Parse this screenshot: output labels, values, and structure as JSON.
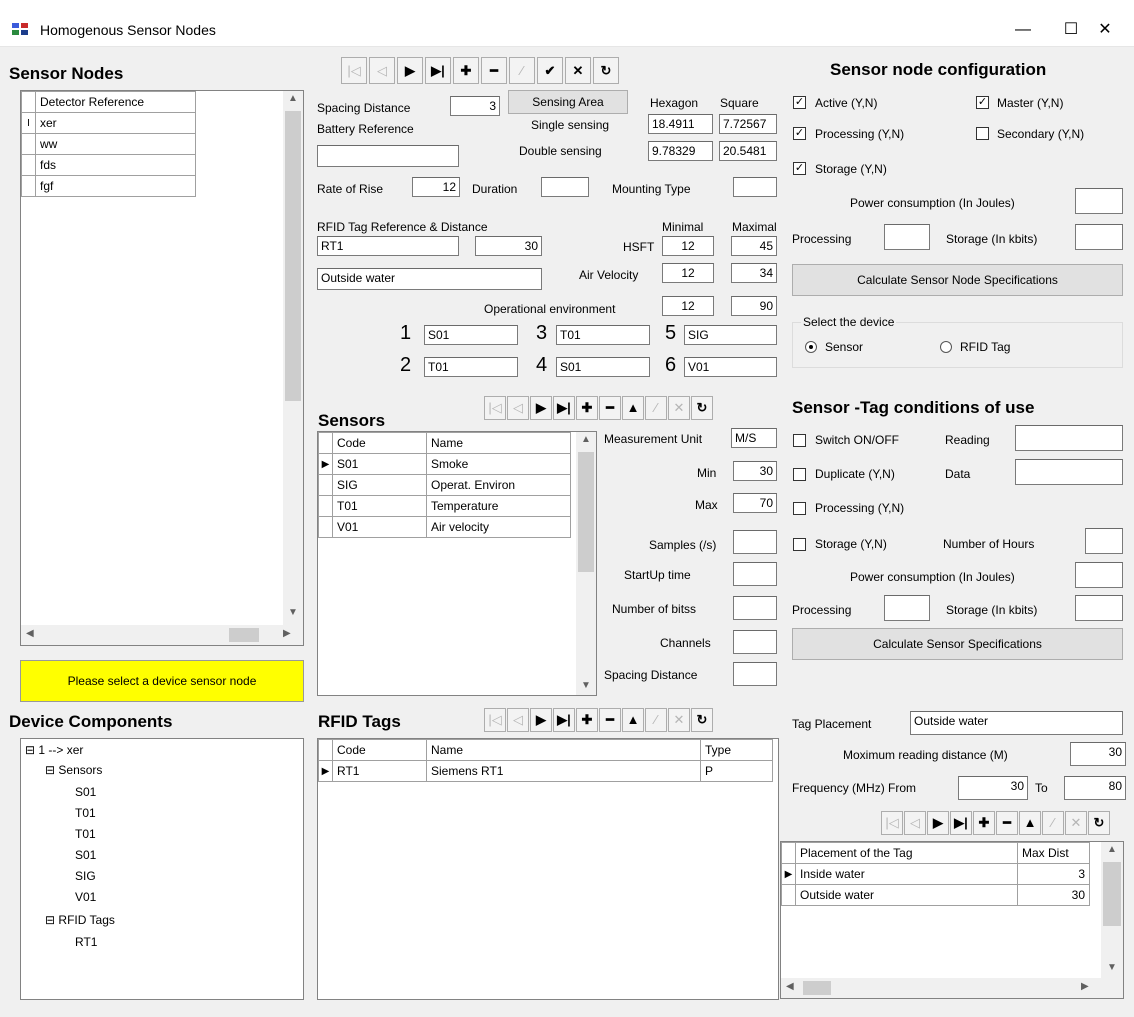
{
  "window": {
    "title": "Homogenous Sensor Nodes",
    "minimize": "—",
    "maximize": "☐",
    "close": "✕"
  },
  "sensor_nodes": {
    "header": "Sensor Nodes",
    "column": "Detector Reference",
    "rows": [
      "xer",
      "ww",
      "fds",
      "fgf"
    ],
    "status": "Please select a device sensor node"
  },
  "device_components": {
    "header": "Device Components",
    "root": "1 --> xer",
    "sensors_label": "Sensors",
    "sensors": [
      "S01",
      "T01",
      "T01",
      "S01",
      "SIG",
      "V01"
    ],
    "tags_label": "RFID Tags",
    "tags": [
      "RT1"
    ]
  },
  "node_form": {
    "spacing_distance_label": "Spacing Distance",
    "spacing_distance": "3",
    "sensing_area_btn": "Sensing Area",
    "hexagon_label": "Hexagon",
    "square_label": "Square",
    "single_sensing_label": "Single sensing",
    "single_hex": "18.4911",
    "single_sq": "7.72567",
    "double_sensing_label": "Double sensing",
    "double_hex": "9.78329",
    "double_sq": "20.5481",
    "battery_reference_label": "Battery Reference",
    "battery_reference": "",
    "rate_of_rise_label": "Rate of Rise",
    "rate_of_rise": "12",
    "duration_label": "Duration",
    "duration": "",
    "mounting_type_label": "Mounting Type",
    "mounting_type": "",
    "rfid_label": "RFID Tag Reference & Distance",
    "rfid_ref": "RT1",
    "rfid_dist": "30",
    "environment": "Outside water",
    "minimal_label": "Minimal",
    "maximal_label": "Maximal",
    "hsft_label": "HSFT",
    "hsft_min": "12",
    "hsft_max": "45",
    "air_velocity_label": "Air Velocity",
    "air_min": "12",
    "air_max": "34",
    "op_env_label": "Operational environment",
    "op_min": "12",
    "op_max": "90",
    "slot_numbers": [
      "1",
      "2",
      "3",
      "4",
      "5",
      "6"
    ],
    "slots": [
      "S01",
      "T01",
      "T01",
      "S01",
      "SIG",
      "V01"
    ]
  },
  "sensors": {
    "header": "Sensors",
    "columns": [
      "Code",
      "Name"
    ],
    "rows": [
      [
        "S01",
        "Smoke"
      ],
      [
        "SIG",
        "Operat. Environ"
      ],
      [
        "T01",
        "Temperature"
      ],
      [
        "V01",
        "Air velocity"
      ]
    ],
    "measurement_unit_label": "Measurement Unit",
    "measurement_unit": "M/S",
    "min_label": "Min",
    "min": "30",
    "max_label": "Max",
    "max": "70",
    "samples_label": "Samples (/s)",
    "startup_label": "StartUp time",
    "bits_label": "Number of bitss",
    "channels_label": "Channels",
    "spacing_label": "Spacing Distance"
  },
  "rfid_tags": {
    "header": "RFID Tags",
    "columns": [
      "Code",
      "Name",
      "Type"
    ],
    "rows": [
      [
        "RT1",
        "Siemens RT1",
        "P"
      ]
    ]
  },
  "config": {
    "header": "Sensor node configuration",
    "active": "Active (Y,N)",
    "master": "Master (Y,N)",
    "processing": "Processing (Y,N)",
    "secondary": "Secondary (Y,N)",
    "storage": "Storage (Y,N)",
    "power_label": "Power consumption (In Joules)",
    "processing_label": "Processing",
    "storage_kbits_label": "Storage (In kbits)",
    "calc_btn": "Calculate Sensor Node Specifications",
    "select_device": "Select the device",
    "radio_sensor": "Sensor",
    "radio_rfid": "RFID Tag"
  },
  "conditions": {
    "header": "Sensor -Tag conditions of use",
    "switch": "Switch ON/OFF",
    "reading_label": "Reading",
    "duplicate": "Duplicate (Y,N)",
    "data_label": "Data",
    "processing": "Processing (Y,N)",
    "storage": "Storage (Y,N)",
    "hours_label": "Number of Hours",
    "power_label": "Power consumption (In Joules)",
    "processing_label": "Processing",
    "storage_kbits_label": "Storage (In kbits)",
    "calc_btn": "Calculate Sensor Specifications"
  },
  "tag_placement": {
    "placement_label": "Tag Placement",
    "placement": "Outside water",
    "max_read_label": "Moximum reading distance (M)",
    "max_read": "30",
    "freq_label": "Frequency (MHz)  From",
    "freq_from": "30",
    "to_label": "To",
    "freq_to": "80",
    "columns": [
      "Placement of the Tag",
      "Max Dist"
    ],
    "rows": [
      [
        "Inside water",
        "3"
      ],
      [
        "Outside water",
        "30"
      ]
    ]
  },
  "nav_glyphs": {
    "first": "|◁",
    "prev": "◁",
    "next": "▶",
    "last": "▶|",
    "add": "✚",
    "del": "━",
    "up": "▲",
    "edit": "⁄",
    "post": "✔",
    "cancel": "✕",
    "refresh": "↻"
  }
}
